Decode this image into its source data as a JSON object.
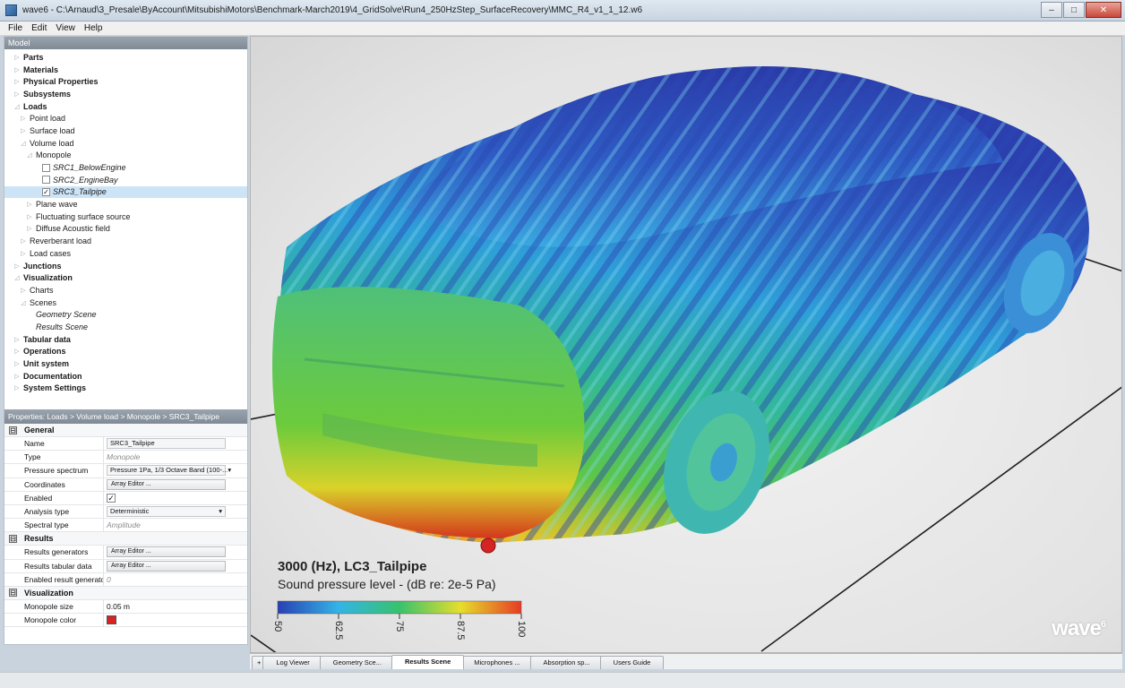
{
  "window": {
    "title": "wave6 - C:\\Arnaud\\3_Presale\\ByAccount\\MitsubishiMotors\\Benchmark-March2019\\4_GridSolve\\Run4_250HzStep_SurfaceRecovery\\MMC_R4_v1_1_12.w6",
    "minimize": "–",
    "maximize": "□",
    "close": "✕"
  },
  "menu": [
    "File",
    "Edit",
    "View",
    "Help"
  ],
  "model": {
    "header": "Model",
    "tree": [
      {
        "label": "Parts",
        "depth": 0,
        "bold": true,
        "expander": "▷"
      },
      {
        "label": "Materials",
        "depth": 0,
        "bold": true,
        "expander": "▷"
      },
      {
        "label": "Physical Properties",
        "depth": 0,
        "bold": true,
        "expander": "▷"
      },
      {
        "label": "Subsystems",
        "depth": 0,
        "bold": true,
        "expander": "▷"
      },
      {
        "label": "Loads",
        "depth": 0,
        "bold": true,
        "expander": "◿"
      },
      {
        "label": "Point load",
        "depth": 1,
        "expander": "▷"
      },
      {
        "label": "Surface load",
        "depth": 1,
        "expander": "▷"
      },
      {
        "label": "Volume load",
        "depth": 1,
        "expander": "◿"
      },
      {
        "label": "Monopole",
        "depth": 2,
        "expander": "◿"
      },
      {
        "label": "SRC1_BelowEngine",
        "depth": 3,
        "italic": true,
        "checkbox": true,
        "checked": false
      },
      {
        "label": "SRC2_EngineBay",
        "depth": 3,
        "italic": true,
        "checkbox": true,
        "checked": false
      },
      {
        "label": "SRC3_Tailpipe",
        "depth": 3,
        "italic": true,
        "checkbox": true,
        "checked": true,
        "selected": true
      },
      {
        "label": "Plane wave",
        "depth": 2,
        "expander": "▷"
      },
      {
        "label": "Fluctuating surface source",
        "depth": 2,
        "expander": "▷"
      },
      {
        "label": "Diffuse Acoustic field",
        "depth": 2,
        "expander": "▷"
      },
      {
        "label": "Reverberant load",
        "depth": 1,
        "expander": "▷"
      },
      {
        "label": "Load cases",
        "depth": 1,
        "expander": "▷"
      },
      {
        "label": "Junctions",
        "depth": 0,
        "bold": true,
        "expander": "▷"
      },
      {
        "label": "Visualization",
        "depth": 0,
        "bold": true,
        "expander": "◿"
      },
      {
        "label": "Charts",
        "depth": 1,
        "expander": "▷"
      },
      {
        "label": "Scenes",
        "depth": 1,
        "expander": "◿"
      },
      {
        "label": "Geometry Scene",
        "depth": 2,
        "italic": true
      },
      {
        "label": "Results Scene",
        "depth": 2,
        "italic": true
      },
      {
        "label": "Tabular data",
        "depth": 0,
        "bold": true,
        "expander": "▷"
      },
      {
        "label": "Operations",
        "depth": 0,
        "bold": true,
        "expander": "▷"
      },
      {
        "label": "Unit system",
        "depth": 0,
        "bold": true,
        "expander": "▷"
      },
      {
        "label": "Documentation",
        "depth": 0,
        "bold": true,
        "expander": "▷"
      },
      {
        "label": "System Settings",
        "depth": 0,
        "bold": true,
        "expander": "▷"
      }
    ]
  },
  "properties": {
    "header": "Properties:  Loads > Volume load > Monopole > SRC3_Tailpipe",
    "collapse_glyph": "⊟",
    "general": {
      "title": "General",
      "name_label": "Name",
      "name_value": "SRC3_Tailpipe",
      "type_label": "Type",
      "type_value": "Monopole",
      "pressure_label": "Pressure spectrum",
      "pressure_value": "Pressure 1Pa, 1/3 Octave Band (100-...",
      "coords_label": "Coordinates",
      "coords_value": "Array Editor ...",
      "enabled_label": "Enabled",
      "enabled_value": "✓",
      "analysis_label": "Analysis type",
      "analysis_value": "Deterministic",
      "spectral_label": "Spectral type",
      "spectral_value": "Amplitude",
      "dropdown_glyph": "▾"
    },
    "results": {
      "title": "Results",
      "gen_label": "Results generators",
      "gen_value": "Array Editor ...",
      "tab_label": "Results tabular data",
      "tab_value": "Array Editor ...",
      "enabled_label": "Enabled result generators",
      "enabled_value": "0"
    },
    "visualization": {
      "title": "Visualization",
      "size_label": "Monopole size",
      "size_value": "0.05 m",
      "color_label": "Monopole color",
      "color_value": "#d42424"
    }
  },
  "legend": {
    "title": "3000 (Hz), LC3_Tailpipe",
    "subtitle": "Sound pressure level - (dB re: 2e-5 Pa)",
    "ticks": [
      "50",
      "62.5",
      "75",
      "87.5",
      "100"
    ],
    "colors": [
      "#2840b4",
      "#34b4e6",
      "#38c26e",
      "#e6de2c",
      "#e63c24"
    ]
  },
  "logo": {
    "text": "wave",
    "sup": "6"
  },
  "tabs": [
    {
      "label": "+",
      "active": false
    },
    {
      "label": "Log Viewer",
      "active": false
    },
    {
      "label": "Geometry Sce...",
      "active": false
    },
    {
      "label": "Results Scene",
      "active": true
    },
    {
      "label": "Microphones ...",
      "active": false
    },
    {
      "label": "Absorption sp...",
      "active": false
    },
    {
      "label": "Users Guide",
      "active": false
    }
  ]
}
